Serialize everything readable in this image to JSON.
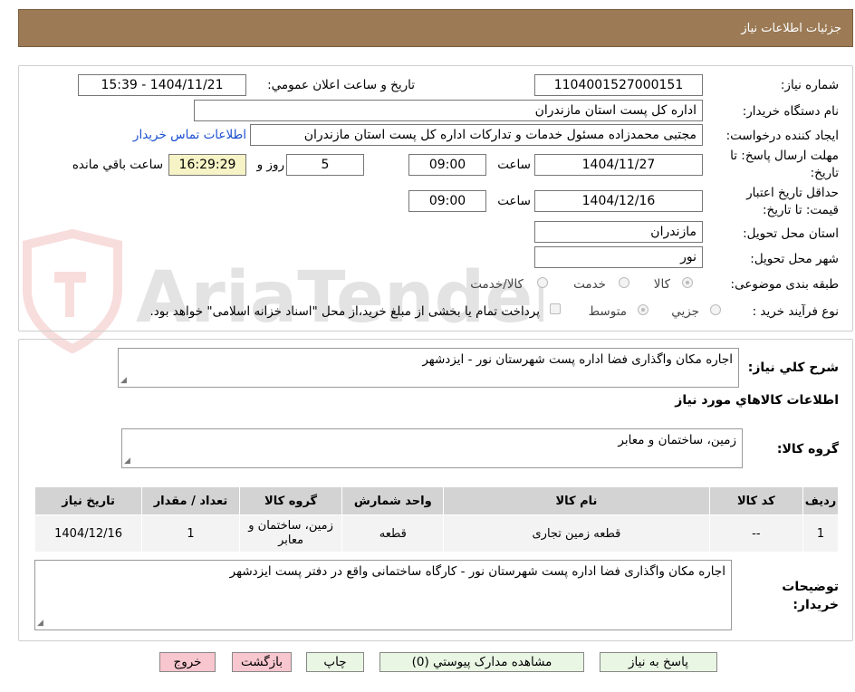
{
  "header": {
    "title": "جزئیات اطلاعات نیاز"
  },
  "form": {
    "need_number_label": "شماره نیاز:",
    "need_number": "1104001527000151",
    "announce_label": "تاریخ و ساعت اعلان عمومي:",
    "announce_value": "1404/11/21 - 15:39",
    "buyer_org_label": "نام دستگاه خريدار:",
    "buyer_org": "اداره کل پست استان مازندران",
    "requester_label": "ايجاد کننده درخواست:",
    "requester": "مجتبی محمدزاده مسئول خدمات و تدارکات اداره کل پست استان مازندران",
    "contact_link": "اطلاعات تماس خريدار",
    "deadline_label": "مهلت ارسال پاسخ: تا تاریخ:",
    "deadline_date": "1404/11/27",
    "time_label": "ساعت",
    "deadline_time": "09:00",
    "days_value": "5",
    "days_label": "روز و",
    "remaining_time": "16:29:29",
    "remaining_label": "ساعت باقي مانده",
    "validity_label": "حداقل تاريخ اعتبار قيمت: تا تاریخ:",
    "validity_date": "1404/12/16",
    "validity_time": "09:00",
    "province_label": "استان محل تحويل:",
    "province": "مازندران",
    "city_label": "شهر محل تحويل:",
    "city": "نور",
    "category_label": "طبقه بندی موضوعی:",
    "category_options": [
      "کالا",
      "خدمت",
      "کالا/خدمت"
    ],
    "process_label": "نوع فرآيند خريد :",
    "process_options": [
      "جزيي",
      "متوسط"
    ],
    "payment_note": "پرداخت تمام يا بخشی از مبلغ خريد،از محل \"اسناد خزانه اسلامی\" خواهد بود."
  },
  "description": {
    "label": "شرح کلي نياز:",
    "text": "اجاره مکان واگذاری فضا اداره پست شهرستان نور - ایزدشهر"
  },
  "goods": {
    "section_title": "اطلاعات کالاهاي مورد نياز",
    "group_label": "گروه کالا:",
    "group_value": "زمین، ساختمان و معابر",
    "columns": [
      "رديف",
      "کد کالا",
      "نام کالا",
      "واحد شمارش",
      "گروه کالا",
      "تعداد / مقدار",
      "تاريخ نياز"
    ],
    "rows": [
      [
        "1",
        "--",
        "قطعه زمین تجاری",
        "قطعه",
        "زمین، ساختمان و معابر",
        "1",
        "1404/12/16"
      ]
    ]
  },
  "buyer_notes": {
    "label": "توضيحات خريدار:",
    "text": "اجاره مکان واگذاری فضا اداره پست شهرستان نور - کارگاه ساختمانی واقع در دفتر پست ایزدشهر"
  },
  "buttons": {
    "reply": "پاسخ به نياز",
    "attachments": "مشاهده مدارک پيوستي (0)",
    "print": "چاپ",
    "back": "بازگشت",
    "exit": "خروج"
  },
  "watermark_text": "AriaTender.neT",
  "colors": {
    "header_bg": "#9b7a55",
    "link": "#1a4fd0",
    "highlight": "#f6f3c6"
  }
}
